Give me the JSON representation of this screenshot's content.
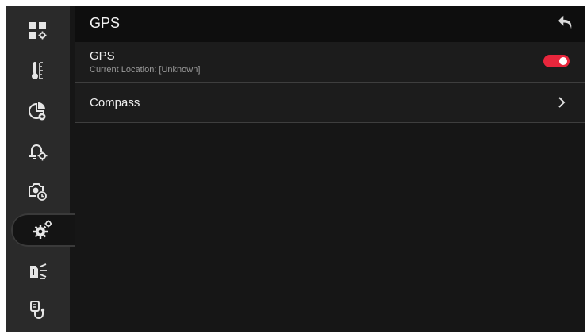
{
  "header": {
    "title": "GPS",
    "back_icon": "back-arrow-icon"
  },
  "sidebar": {
    "items": [
      {
        "name": "dashboard-settings",
        "icon": "grid-gear-icon",
        "active": false
      },
      {
        "name": "temperature",
        "icon": "thermometer-icon",
        "active": false
      },
      {
        "name": "power-settings",
        "icon": "pie-gear-icon",
        "active": false
      },
      {
        "name": "alarm-settings",
        "icon": "bell-gear-icon",
        "active": false
      },
      {
        "name": "camera-timer",
        "icon": "camera-timer-icon",
        "active": false
      },
      {
        "name": "system-settings",
        "icon": "gears-icon",
        "active": true
      },
      {
        "name": "cooling",
        "icon": "airflow-icon",
        "active": false
      },
      {
        "name": "diagnostics",
        "icon": "stethoscope-icon",
        "active": false
      }
    ]
  },
  "list": {
    "gps": {
      "title": "GPS",
      "subtitle": "Current Location: [Unknown]",
      "enabled": true
    },
    "compass": {
      "title": "Compass"
    }
  },
  "colors": {
    "toggle_on": "#e8263c",
    "background": "#161616",
    "sidebar": "#2a2a2a"
  }
}
